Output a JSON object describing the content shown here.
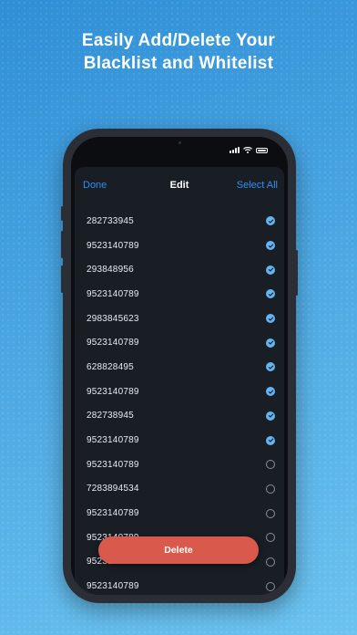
{
  "headline": {
    "line1": "Easily Add/Delete Your",
    "line2": "Blacklist and Whitelist"
  },
  "status_bar": {
    "icons": [
      "signal-icon",
      "wifi-icon",
      "battery-icon"
    ]
  },
  "sheet": {
    "done_label": "Done",
    "title": "Edit",
    "select_all_label": "Select All"
  },
  "items": [
    {
      "number": "282733945",
      "selected": true
    },
    {
      "number": "9523140789",
      "selected": true
    },
    {
      "number": "293848956",
      "selected": true
    },
    {
      "number": "9523140789",
      "selected": true
    },
    {
      "number": "2983845623",
      "selected": true
    },
    {
      "number": "9523140789",
      "selected": true
    },
    {
      "number": "628828495",
      "selected": true
    },
    {
      "number": "9523140789",
      "selected": true
    },
    {
      "number": "282738945",
      "selected": true
    },
    {
      "number": "9523140789",
      "selected": true
    },
    {
      "number": "9523140789",
      "selected": false
    },
    {
      "number": "7283894534",
      "selected": false
    },
    {
      "number": "9523140789",
      "selected": false
    },
    {
      "number": "9523140789",
      "selected": false
    },
    {
      "number": "9523140789",
      "selected": false
    },
    {
      "number": "9523140789",
      "selected": false
    }
  ],
  "delete_label": "Delete",
  "colors": {
    "accent": "#2f8ff0",
    "checked": "#62b4f2",
    "delete": "#d95a4d",
    "sheet_bg": "#191d24"
  }
}
